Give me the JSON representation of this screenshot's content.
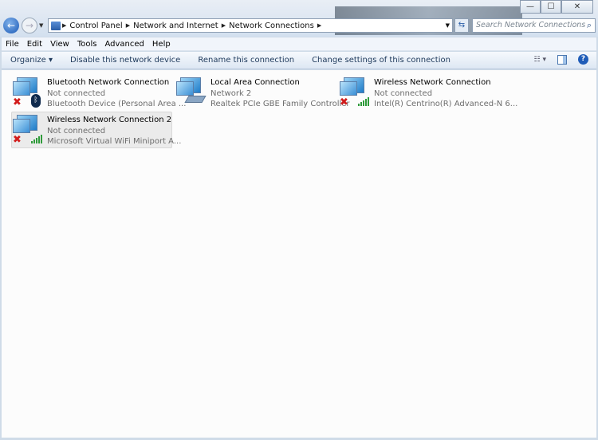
{
  "window": {
    "minimize": "—",
    "maximize": "☐",
    "close": "✕"
  },
  "address": {
    "segments": [
      "Control Panel",
      "Network and Internet",
      "Network Connections"
    ]
  },
  "search": {
    "placeholder": "Search Network Connections"
  },
  "menu": [
    "File",
    "Edit",
    "View",
    "Tools",
    "Advanced",
    "Help"
  ],
  "toolbar": {
    "organize": "Organize ▾",
    "disable": "Disable this network device",
    "rename": "Rename this connection",
    "change": "Change settings of this connection"
  },
  "connections": [
    {
      "name": "Bluetooth Network Connection",
      "status": "Not connected",
      "device": "Bluetooth Device (Personal Area ...",
      "type": "bluetooth",
      "disconnected": true,
      "selected": false
    },
    {
      "name": "Local Area Connection",
      "status": "Network  2",
      "device": "Realtek PCIe GBE Family Controller",
      "type": "ethernet",
      "disconnected": false,
      "selected": false
    },
    {
      "name": "Wireless Network Connection",
      "status": "Not connected",
      "device": "Intel(R) Centrino(R) Advanced-N 6...",
      "type": "wireless",
      "disconnected": true,
      "selected": false
    },
    {
      "name": "Wireless Network Connection 2",
      "status": "Not connected",
      "device": "Microsoft Virtual WiFi Miniport A...",
      "type": "wireless",
      "disconnected": true,
      "selected": true
    }
  ]
}
